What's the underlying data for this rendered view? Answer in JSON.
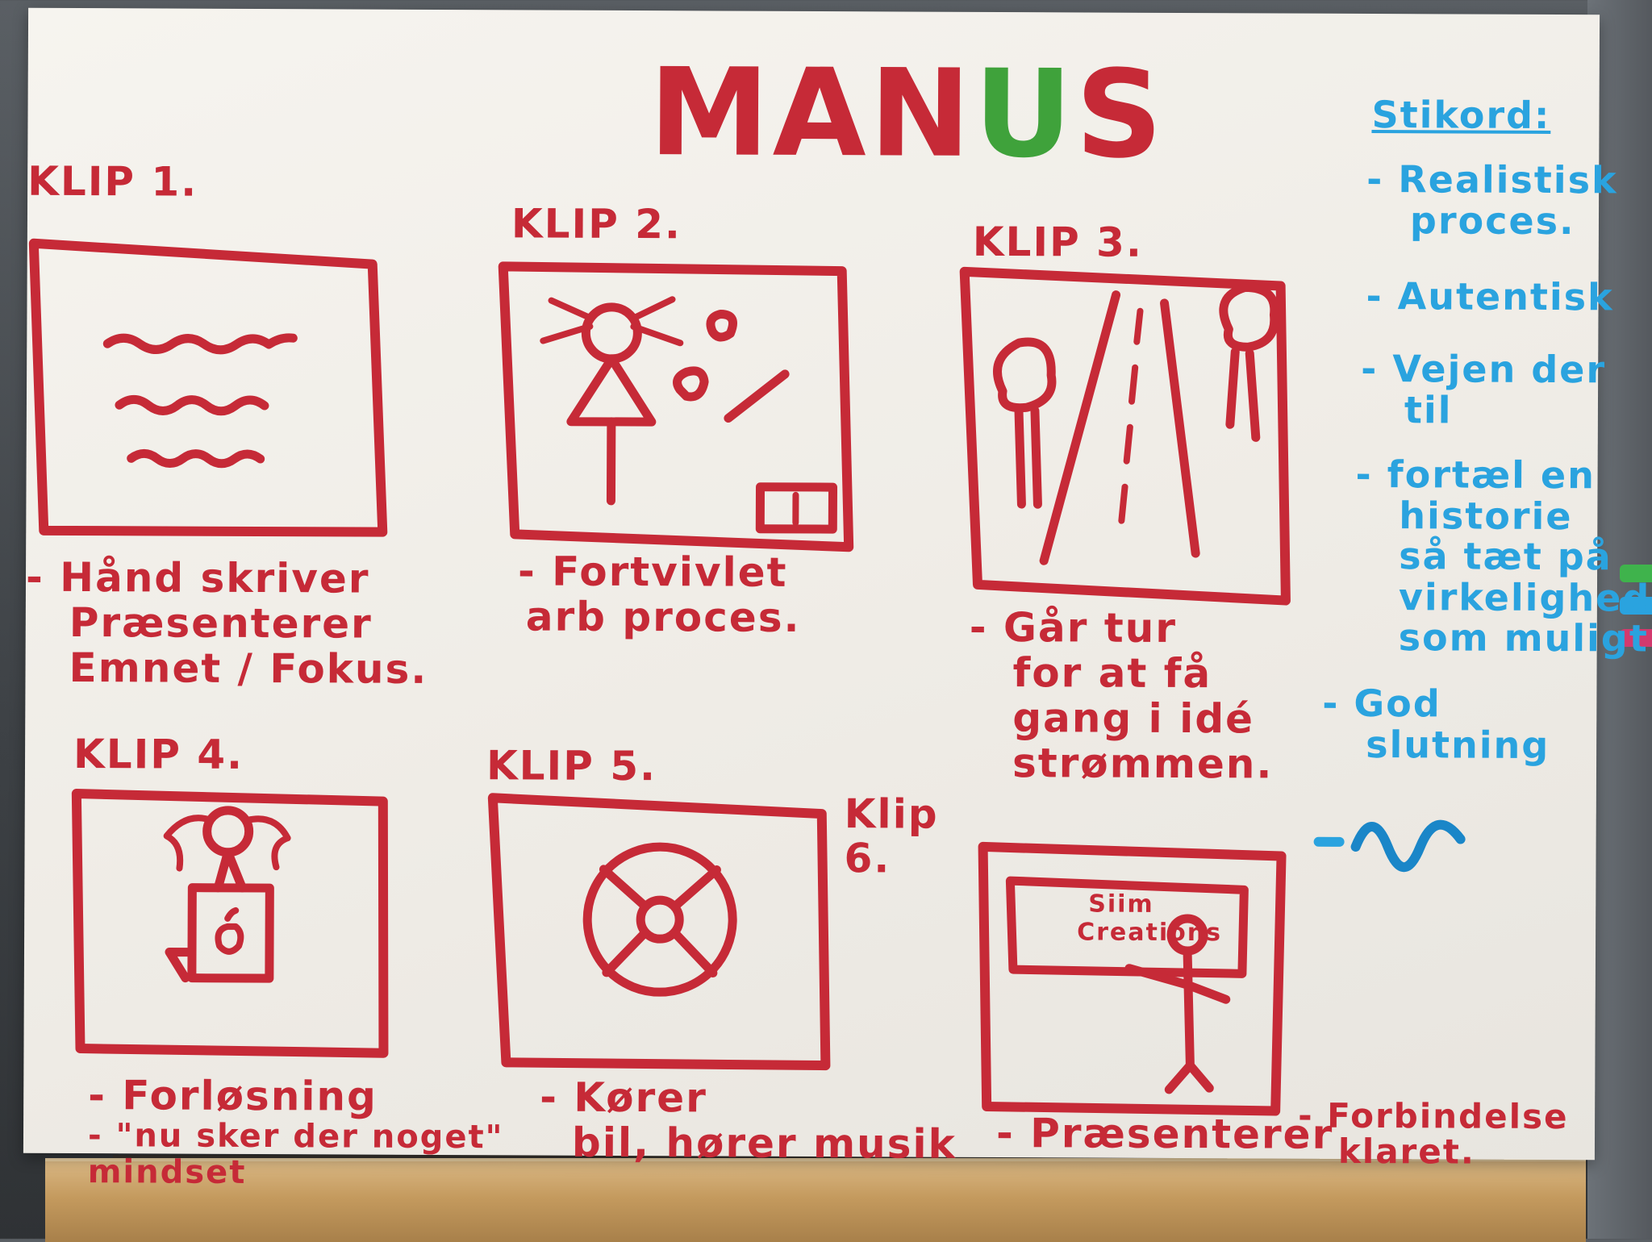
{
  "colors": {
    "ink_red": "#c62a37",
    "ink_green": "#3fa23b",
    "ink_blue": "#2aa3df",
    "paper": "#f3f1ec",
    "stand": "#c9a064"
  },
  "title": {
    "main": "MAN",
    "highlight": "U",
    "end": "S"
  },
  "clips": [
    {
      "label": "KLIP 1.",
      "caption_lines": [
        "- Hånd skriver",
        "Præsenterer",
        "Emnet / Fokus."
      ]
    },
    {
      "label": "KLIP 2.",
      "caption_lines": [
        "- Fortvivlet",
        "arb proces."
      ]
    },
    {
      "label": "KLIP 3.",
      "caption_lines": [
        "- Går tur",
        "for at få",
        "gang i idé",
        "strømmen."
      ]
    },
    {
      "label": "KLIP 4.",
      "caption_lines": [
        "- Forløsning",
        "- \"nu sker der noget\"",
        "mindset"
      ]
    },
    {
      "label": "KLIP 5.",
      "caption_lines": [
        "- Kører",
        "bil, hører musik"
      ]
    },
    {
      "label_lines": [
        "Klip",
        "6."
      ],
      "caption_lines": [
        "- Præsenterer"
      ],
      "board_text_lines": [
        "Siim",
        "Creations"
      ]
    }
  ],
  "extra_note_lines": [
    "- Forbindelse",
    "klaret."
  ],
  "stikord": {
    "heading": "Stikord:",
    "items": [
      {
        "lines": [
          "- Realistisk",
          "proces."
        ]
      },
      {
        "lines": [
          "- Autentisk"
        ]
      },
      {
        "lines": [
          "- Vejen der",
          "til"
        ]
      },
      {
        "lines": [
          "- fortæl en",
          "historie",
          "så tæt på",
          "virkelighed",
          "som muligt"
        ]
      },
      {
        "lines": [
          "- God",
          "slutning"
        ]
      }
    ],
    "end_mark_icon": "squiggle-icon"
  }
}
